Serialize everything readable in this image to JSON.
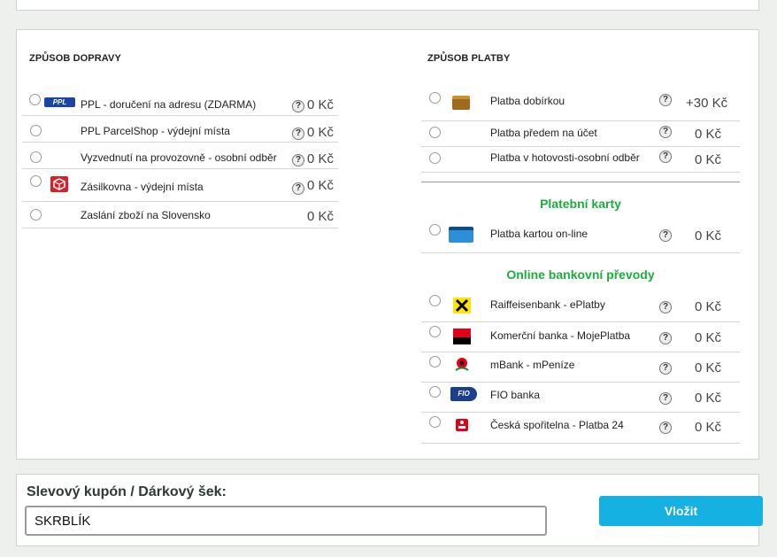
{
  "shipping": {
    "title": "ZPŮSOB DOPRAVY",
    "items": [
      {
        "label": "PPL - doručení na adresu (ZDARMA)",
        "price": "0 Kč",
        "logo": "ppl-logo",
        "logo_text": "PPL"
      },
      {
        "label": "PPL ParcelShop - výdejní místa",
        "price": "0 Kč"
      },
      {
        "label": "Vyzvednutí na provozovně - osobní odběr",
        "price": "0 Kč"
      },
      {
        "label": "Zásilkovna - výdejní místa",
        "price": "0 Kč",
        "logo": "zasilkovna-logo"
      },
      {
        "label": "Zaslání zboží na Slovensko",
        "price": "0 Kč"
      }
    ]
  },
  "payment": {
    "title": "ZPŮSOB PLATBY",
    "basic": [
      {
        "label": "Platba dobírkou",
        "price": "+30 Kč",
        "logo": "wallet-icon"
      },
      {
        "label": "Platba předem na účet",
        "price": "0 Kč"
      },
      {
        "label": "Platba v hotovosti-osobní odběr",
        "price": "0 Kč"
      }
    ],
    "cards_title": "Platební karty",
    "cards": [
      {
        "label": "Platba kartou on-line",
        "price": "0 Kč",
        "logo": "credit-card-icon"
      }
    ],
    "banks_title": "Online bankovní převody",
    "banks": [
      {
        "label": "Raiffeisenbank - ePlatby",
        "price": "0 Kč",
        "logo": "raiffeisen-logo"
      },
      {
        "label": "Komerční banka - MojePlatba",
        "price": "0 Kč",
        "logo": "komercni-banka-logo"
      },
      {
        "label": "mBank - mPeníze",
        "price": "0 Kč",
        "logo": "mbank-logo"
      },
      {
        "label": "FIO banka",
        "price": "0 Kč",
        "logo": "fio-logo",
        "logo_text": "FIO"
      },
      {
        "label": "Česká spořitelna - Platba 24",
        "price": "0 Kč",
        "logo": "ceska-sporitelna-logo"
      }
    ]
  },
  "help_symbol": "?",
  "coupon": {
    "label": "Slevový kupón / Dárkový šek:",
    "value": "SKRBLÍK",
    "button_label": "Vložit"
  },
  "colors": {
    "group_title": "#1aae3c",
    "button": "#15b1e3"
  }
}
